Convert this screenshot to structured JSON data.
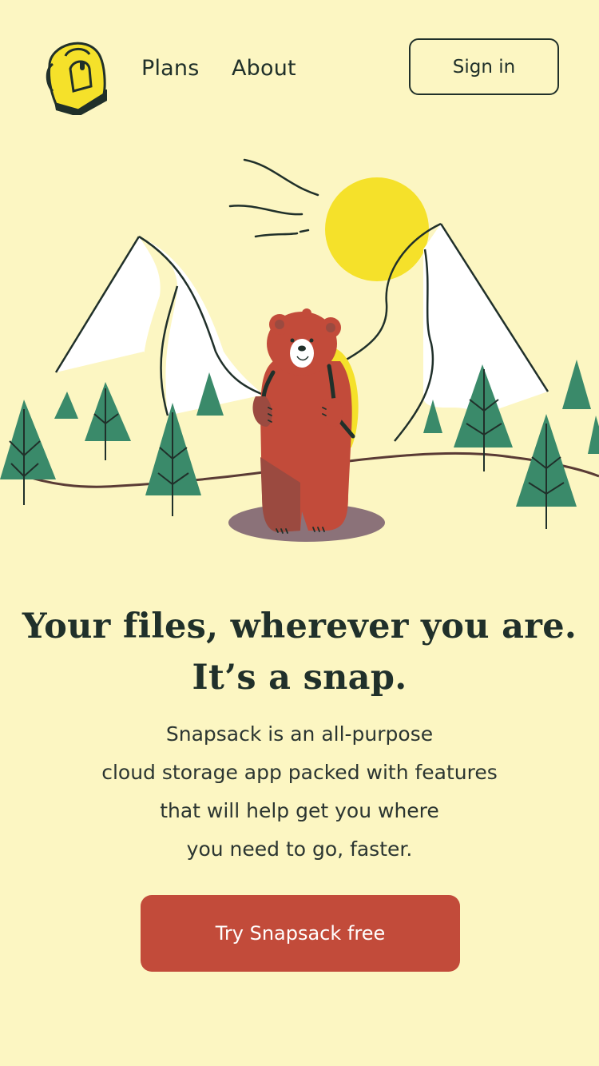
{
  "nav": {
    "logo_icon": "backpack-logo-icon",
    "links": [
      {
        "label": "Plans"
      },
      {
        "label": "About"
      }
    ],
    "signin_label": "Sign in"
  },
  "hero": {
    "illustration": "bear-hiking-mountains-illustration"
  },
  "headline": {
    "line1": "Your files, wherever you are.",
    "line2": "It’s a snap."
  },
  "lead": {
    "line1": "Snapsack is an all-purpose",
    "line2": "cloud storage app packed with features",
    "line3": "that will help get you where",
    "line4": "you need to go, faster."
  },
  "cta": {
    "label": "Try Snapsack free"
  },
  "colors": {
    "background": "#fcf6c2",
    "text": "#20302a",
    "accent": "#c24b3a",
    "sun": "#f5e12a",
    "tree": "#3a8a6a",
    "bear": "#c24b3a"
  }
}
